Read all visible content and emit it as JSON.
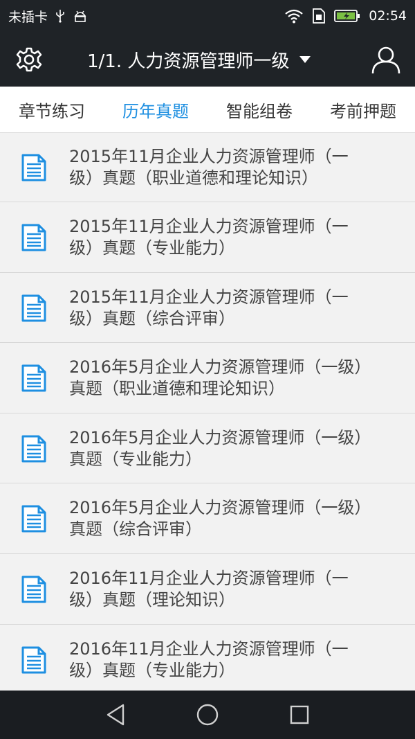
{
  "status_bar": {
    "carrier": "未插卡",
    "time": "02:54",
    "icons": [
      "usb-icon",
      "android-debug-icon",
      "wifi-icon",
      "sim-icon",
      "battery-charging-icon"
    ]
  },
  "app_bar": {
    "title": "1/1. 人力资源管理师一级",
    "settings_icon": "gear-icon",
    "dropdown_icon": "caret-down-icon",
    "user_icon": "user-icon"
  },
  "tabs": [
    {
      "label": "章节练习",
      "active": false
    },
    {
      "label": "历年真题",
      "active": true
    },
    {
      "label": "智能组卷",
      "active": false
    },
    {
      "label": "考前押题",
      "active": false
    }
  ],
  "colors": {
    "accent": "#1e8fe1",
    "bar": "#1f2327",
    "list_bg": "#f2f2f2",
    "doc_icon": "#1e8fe1"
  },
  "exam_list": [
    {
      "title": "2015年11月企业人力资源管理师（一级）真题（职业道德和理论知识）",
      "line1": "2015年11月企业人力资源管理师（一",
      "line2": "级）真题（职业道德和理论知识）"
    },
    {
      "title": "2015年11月企业人力资源管理师（一级）真题（专业能力）",
      "line1": "2015年11月企业人力资源管理师（一",
      "line2": "级）真题（专业能力）"
    },
    {
      "title": "2015年11月企业人力资源管理师（一级）真题（综合评审）",
      "line1": "2015年11月企业人力资源管理师（一",
      "line2": "级）真题（综合评审）"
    },
    {
      "title": "2016年5月企业人力资源管理师（一级）真题（职业道德和理论知识）",
      "line1": "2016年5月企业人力资源管理师（一级）",
      "line2": "真题（职业道德和理论知识）"
    },
    {
      "title": "2016年5月企业人力资源管理师（一级）真题（专业能力）",
      "line1": "2016年5月企业人力资源管理师（一级）",
      "line2": "真题（专业能力）"
    },
    {
      "title": "2016年5月企业人力资源管理师（一级）真题（综合评审）",
      "line1": "2016年5月企业人力资源管理师（一级）",
      "line2": "真题（综合评审）"
    },
    {
      "title": "2016年11月企业人力资源管理师（一级）真题（理论知识）",
      "line1": "2016年11月企业人力资源管理师（一",
      "line2": "级）真题（理论知识）"
    },
    {
      "title": "2016年11月企业人力资源管理师（一级）真题（专业能力）",
      "line1": "2016年11月企业人力资源管理师（一",
      "line2": "级）真题（专业能力）"
    }
  ],
  "nav_bar": {
    "back_icon": "back-triangle-icon",
    "home_icon": "home-circle-icon",
    "recents_icon": "recents-square-icon"
  }
}
